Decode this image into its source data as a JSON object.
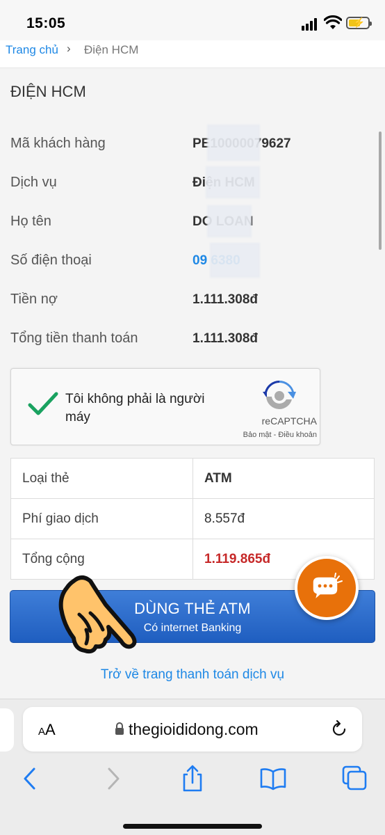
{
  "status": {
    "time": "15:05"
  },
  "breadcrumb": {
    "home": "Trang chủ",
    "separator": "›",
    "current": "Điện HCM"
  },
  "page": {
    "title": "ĐIỆN HCM"
  },
  "customer": [
    {
      "label": "Mã khách hàng",
      "value": "PE10000079627",
      "link": false
    },
    {
      "label": "Dịch vụ",
      "value": "Điện HCM",
      "link": false
    },
    {
      "label": "Họ tên",
      "value": "DO      LOAN",
      "link": false
    },
    {
      "label": "Số điện thoại",
      "value": "09          6380",
      "link": true
    },
    {
      "label": "Tiền nợ",
      "value": "1.111.308đ",
      "link": false
    },
    {
      "label": "Tổng tiền thanh toán",
      "value": "1.111.308đ",
      "link": false
    }
  ],
  "recaptcha": {
    "label": "Tôi không phải là người máy",
    "brand": "reCAPTCHA",
    "terms": "Bảo mật - Điều khoản",
    "checked": true
  },
  "payment": {
    "rows": [
      {
        "label": "Loại thẻ",
        "value": "ATM"
      },
      {
        "label": "Phí giao dịch",
        "value": "8.557đ"
      },
      {
        "label": "Tổng cộng",
        "value": "1.119.865đ"
      }
    ]
  },
  "submit": {
    "label": "DÙNG THẺ ATM",
    "sublabel": "Có internet Banking"
  },
  "back_link": "Trở về trang thanh toán dịch vụ",
  "browser": {
    "aa_small": "A",
    "aa_big": "A",
    "url": "thegioididong.com"
  },
  "colors": {
    "accent": "#1e88e5",
    "button": "#2b6bd0",
    "total": "#c62828",
    "chat": "#e8710a",
    "check": "#1aa260"
  },
  "icons": [
    "signal-icon",
    "wifi-icon",
    "battery-icon",
    "checkmark-icon",
    "recaptcha-logo-icon",
    "chat-icon",
    "pointing-hand-icon",
    "lock-icon",
    "reload-icon",
    "back-icon",
    "forward-icon",
    "share-icon",
    "bookmarks-icon",
    "tabs-icon"
  ]
}
